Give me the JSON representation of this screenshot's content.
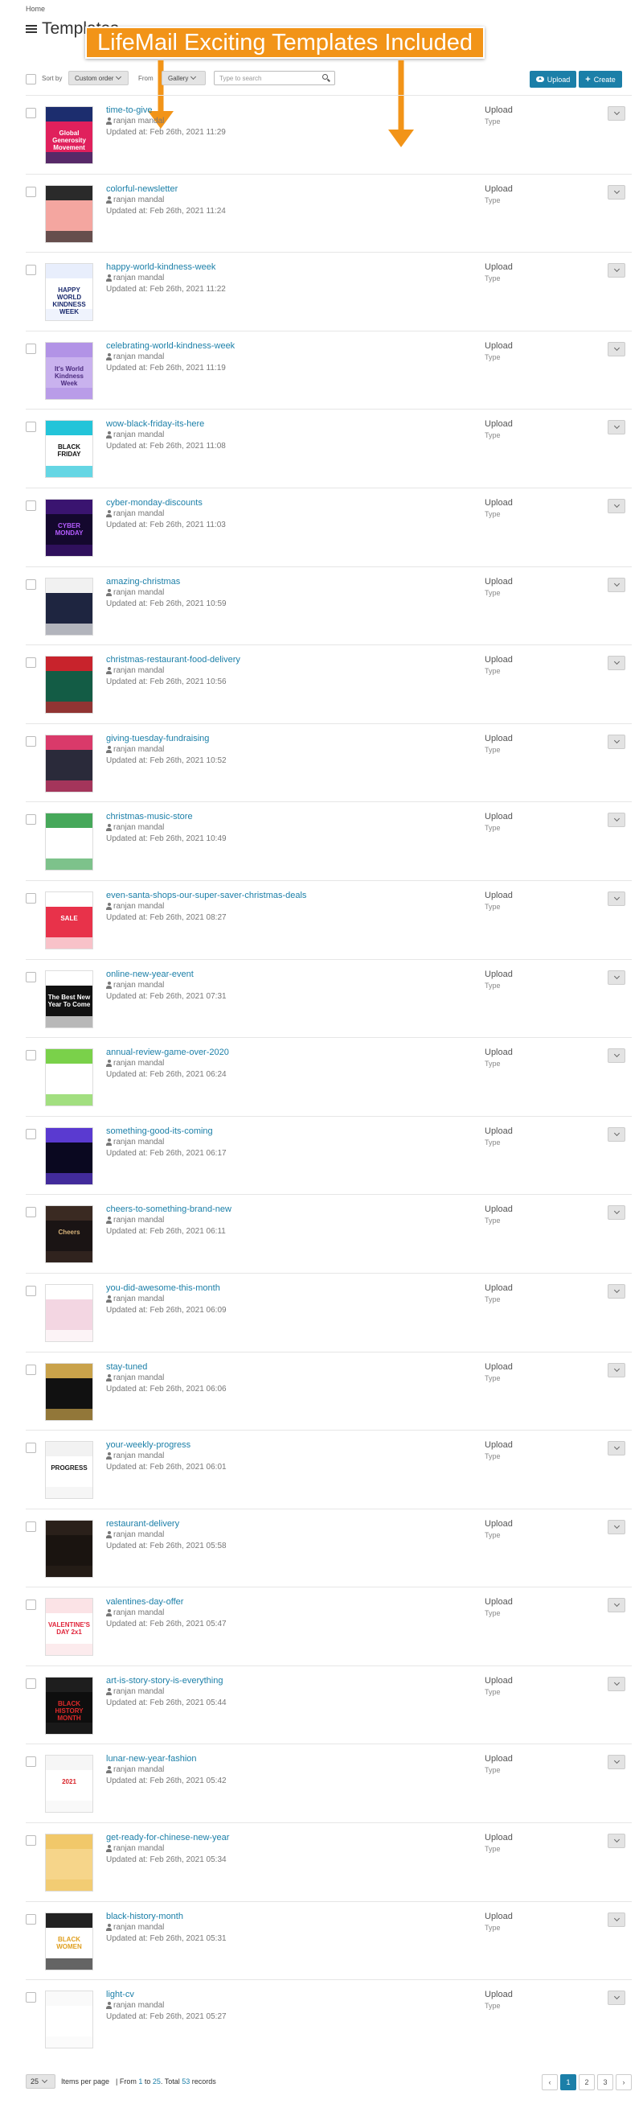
{
  "breadcrumb": "Home",
  "page_title": "Templates",
  "banner_text": "LifeMail Exciting Templates Included",
  "toolbar": {
    "sort_label": "Sort by",
    "sort_value": "Custom order",
    "from_label": "From",
    "from_value": "Gallery",
    "search_placeholder": "Type to search",
    "upload_label": "Upload",
    "create_label": "Create"
  },
  "templates": [
    {
      "name": "time-to-give",
      "author": "ranjan mandal",
      "updated": "Updated at: Feb 26th, 2021 11:29",
      "type": "Upload",
      "type_label": "Type",
      "thumb": {
        "bg": "#e0205c",
        "band": "#1c2d6e",
        "text": "Global Generosity Movement",
        "fg": "#ffffff"
      }
    },
    {
      "name": "colorful-newsletter",
      "author": "ranjan mandal",
      "updated": "Updated at: Feb 26th, 2021 11:24",
      "type": "Upload",
      "type_label": "Type",
      "thumb": {
        "bg": "#f4a6a0",
        "band": "#2a2a2a",
        "text": "",
        "fg": "#ffffff"
      }
    },
    {
      "name": "happy-world-kindness-week",
      "author": "ranjan mandal",
      "updated": "Updated at: Feb 26th, 2021 11:22",
      "type": "Upload",
      "type_label": "Type",
      "thumb": {
        "bg": "#ffffff",
        "band": "#e8eefc",
        "text": "HAPPY WORLD KINDNESS WEEK",
        "fg": "#1a2a6e"
      }
    },
    {
      "name": "celebrating-world-kindness-week",
      "author": "ranjan mandal",
      "updated": "Updated at: Feb 26th, 2021 11:19",
      "type": "Upload",
      "type_label": "Type",
      "thumb": {
        "bg": "#c9b2ee",
        "band": "#b293e6",
        "text": "It's World Kindness Week",
        "fg": "#4a2a7e"
      }
    },
    {
      "name": "wow-black-friday-its-here",
      "author": "ranjan mandal",
      "updated": "Updated at: Feb 26th, 2021 11:08",
      "type": "Upload",
      "type_label": "Type",
      "thumb": {
        "bg": "#ffffff",
        "band": "#23c4d9",
        "text": "BLACK FRIDAY",
        "fg": "#111111"
      }
    },
    {
      "name": "cyber-monday-discounts",
      "author": "ranjan mandal",
      "updated": "Updated at: Feb 26th, 2021 11:03",
      "type": "Upload",
      "type_label": "Type",
      "thumb": {
        "bg": "#14082e",
        "band": "#3a1470",
        "text": "CYBER MONDAY",
        "fg": "#b45cff"
      }
    },
    {
      "name": "amazing-christmas",
      "author": "ranjan mandal",
      "updated": "Updated at: Feb 26th, 2021 10:59",
      "type": "Upload",
      "type_label": "Type",
      "thumb": {
        "bg": "#1e2540",
        "band": "#f1f1f1",
        "text": "",
        "fg": "#ffffff"
      }
    },
    {
      "name": "christmas-restaurant-food-delivery",
      "author": "ranjan mandal",
      "updated": "Updated at: Feb 26th, 2021 10:56",
      "type": "Upload",
      "type_label": "Type",
      "thumb": {
        "bg": "#135c45",
        "band": "#c8232c",
        "text": "",
        "fg": "#ffffff"
      }
    },
    {
      "name": "giving-tuesday-fundraising",
      "author": "ranjan mandal",
      "updated": "Updated at: Feb 26th, 2021 10:52",
      "type": "Upload",
      "type_label": "Type",
      "thumb": {
        "bg": "#2a2a3a",
        "band": "#d93a6a",
        "text": "",
        "fg": "#ffffff"
      }
    },
    {
      "name": "christmas-music-store",
      "author": "ranjan mandal",
      "updated": "Updated at: Feb 26th, 2021 10:49",
      "type": "Upload",
      "type_label": "Type",
      "thumb": {
        "bg": "#ffffff",
        "band": "#46a85a",
        "text": "",
        "fg": "#333333"
      }
    },
    {
      "name": "even-santa-shops-our-super-saver-christmas-deals",
      "author": "ranjan mandal",
      "updated": "Updated at: Feb 26th, 2021 08:27",
      "type": "Upload",
      "type_label": "Type",
      "thumb": {
        "bg": "#e8324a",
        "band": "#ffffff",
        "text": "SALE",
        "fg": "#ffffff"
      }
    },
    {
      "name": "online-new-year-event",
      "author": "ranjan mandal",
      "updated": "Updated at: Feb 26th, 2021 07:31",
      "type": "Upload",
      "type_label": "Type",
      "thumb": {
        "bg": "#111111",
        "band": "#ffffff",
        "text": "The Best New Year To Come",
        "fg": "#ffffff"
      }
    },
    {
      "name": "annual-review-game-over-2020",
      "author": "ranjan mandal",
      "updated": "Updated at: Feb 26th, 2021 06:24",
      "type": "Upload",
      "type_label": "Type",
      "thumb": {
        "bg": "#ffffff",
        "band": "#7ad14a",
        "text": "",
        "fg": "#e8328a"
      }
    },
    {
      "name": "something-good-its-coming",
      "author": "ranjan mandal",
      "updated": "Updated at: Feb 26th, 2021 06:17",
      "type": "Upload",
      "type_label": "Type",
      "thumb": {
        "bg": "#0a0820",
        "band": "#5a3ad0",
        "text": "",
        "fg": "#ffffff"
      }
    },
    {
      "name": "cheers-to-something-brand-new",
      "author": "ranjan mandal",
      "updated": "Updated at: Feb 26th, 2021 06:11",
      "type": "Upload",
      "type_label": "Type",
      "thumb": {
        "bg": "#1a1414",
        "band": "#3a2a22",
        "text": "Cheers",
        "fg": "#d8b47a"
      }
    },
    {
      "name": "you-did-awesome-this-month",
      "author": "ranjan mandal",
      "updated": "Updated at: Feb 26th, 2021 06:09",
      "type": "Upload",
      "type_label": "Type",
      "thumb": {
        "bg": "#f3d6e2",
        "band": "#ffffff",
        "text": "",
        "fg": "#333333"
      }
    },
    {
      "name": "stay-tuned",
      "author": "ranjan mandal",
      "updated": "Updated at: Feb 26th, 2021 06:06",
      "type": "Upload",
      "type_label": "Type",
      "thumb": {
        "bg": "#111111",
        "band": "#c9a24a",
        "text": "",
        "fg": "#ffffff"
      }
    },
    {
      "name": "your-weekly-progress",
      "author": "ranjan mandal",
      "updated": "Updated at: Feb 26th, 2021 06:01",
      "type": "Upload",
      "type_label": "Type",
      "thumb": {
        "bg": "#ffffff",
        "band": "#f2f2f2",
        "text": "PROGRESS",
        "fg": "#1a1a1a"
      }
    },
    {
      "name": "restaurant-delivery",
      "author": "ranjan mandal",
      "updated": "Updated at: Feb 26th, 2021 05:58",
      "type": "Upload",
      "type_label": "Type",
      "thumb": {
        "bg": "#1a1410",
        "band": "#2a201a",
        "text": "",
        "fg": "#ffffff"
      }
    },
    {
      "name": "valentines-day-offer",
      "author": "ranjan mandal",
      "updated": "Updated at: Feb 26th, 2021 05:47",
      "type": "Upload",
      "type_label": "Type",
      "thumb": {
        "bg": "#ffffff",
        "band": "#fbe3e6",
        "text": "VALENTINE'S DAY 2x1",
        "fg": "#e0243a"
      }
    },
    {
      "name": "art-is-story-story-is-everything",
      "author": "ranjan mandal",
      "updated": "Updated at: Feb 26th, 2021 05:44",
      "type": "Upload",
      "type_label": "Type",
      "thumb": {
        "bg": "#0e0e0e",
        "band": "#1e1e1e",
        "text": "BLACK HISTORY MONTH",
        "fg": "#e02a2a"
      }
    },
    {
      "name": "lunar-new-year-fashion",
      "author": "ranjan mandal",
      "updated": "Updated at: Feb 26th, 2021 05:42",
      "type": "Upload",
      "type_label": "Type",
      "thumb": {
        "bg": "#ffffff",
        "band": "#f6f6f6",
        "text": "2021",
        "fg": "#d8242a"
      }
    },
    {
      "name": "get-ready-for-chinese-new-year",
      "author": "ranjan mandal",
      "updated": "Updated at: Feb 26th, 2021 05:34",
      "type": "Upload",
      "type_label": "Type",
      "thumb": {
        "bg": "#f6d58a",
        "band": "#f1c86a",
        "text": "",
        "fg": "#b8201e"
      }
    },
    {
      "name": "black-history-month",
      "author": "ranjan mandal",
      "updated": "Updated at: Feb 26th, 2021 05:31",
      "type": "Upload",
      "type_label": "Type",
      "thumb": {
        "bg": "#ffffff",
        "band": "#222222",
        "text": "BLACK WOMEN",
        "fg": "#e0a020"
      }
    },
    {
      "name": "light-cv",
      "author": "ranjan mandal",
      "updated": "Updated at: Feb 26th, 2021 05:27",
      "type": "Upload",
      "type_label": "Type",
      "thumb": {
        "bg": "#ffffff",
        "band": "#fafafa",
        "text": "",
        "fg": "#333333"
      }
    }
  ],
  "footer": {
    "per_page": "25",
    "per_page_label": "Items per page",
    "records_prefix": "| From ",
    "range_start": "1",
    "records_to": " to ",
    "range_end": "25",
    "records_total_label": ". Total ",
    "total": "53",
    "records_suffix": " records",
    "pages": [
      "‹",
      "1",
      "2",
      "3",
      "›"
    ],
    "active_page": "1"
  },
  "colors": {
    "accent": "#1b7fa8",
    "banner": "#f29418"
  },
  "icons": [
    "list-icon",
    "cloud-upload-icon",
    "plus-icon",
    "search-icon",
    "user-icon",
    "chevron-down-icon",
    "arrow-down-icon"
  ]
}
